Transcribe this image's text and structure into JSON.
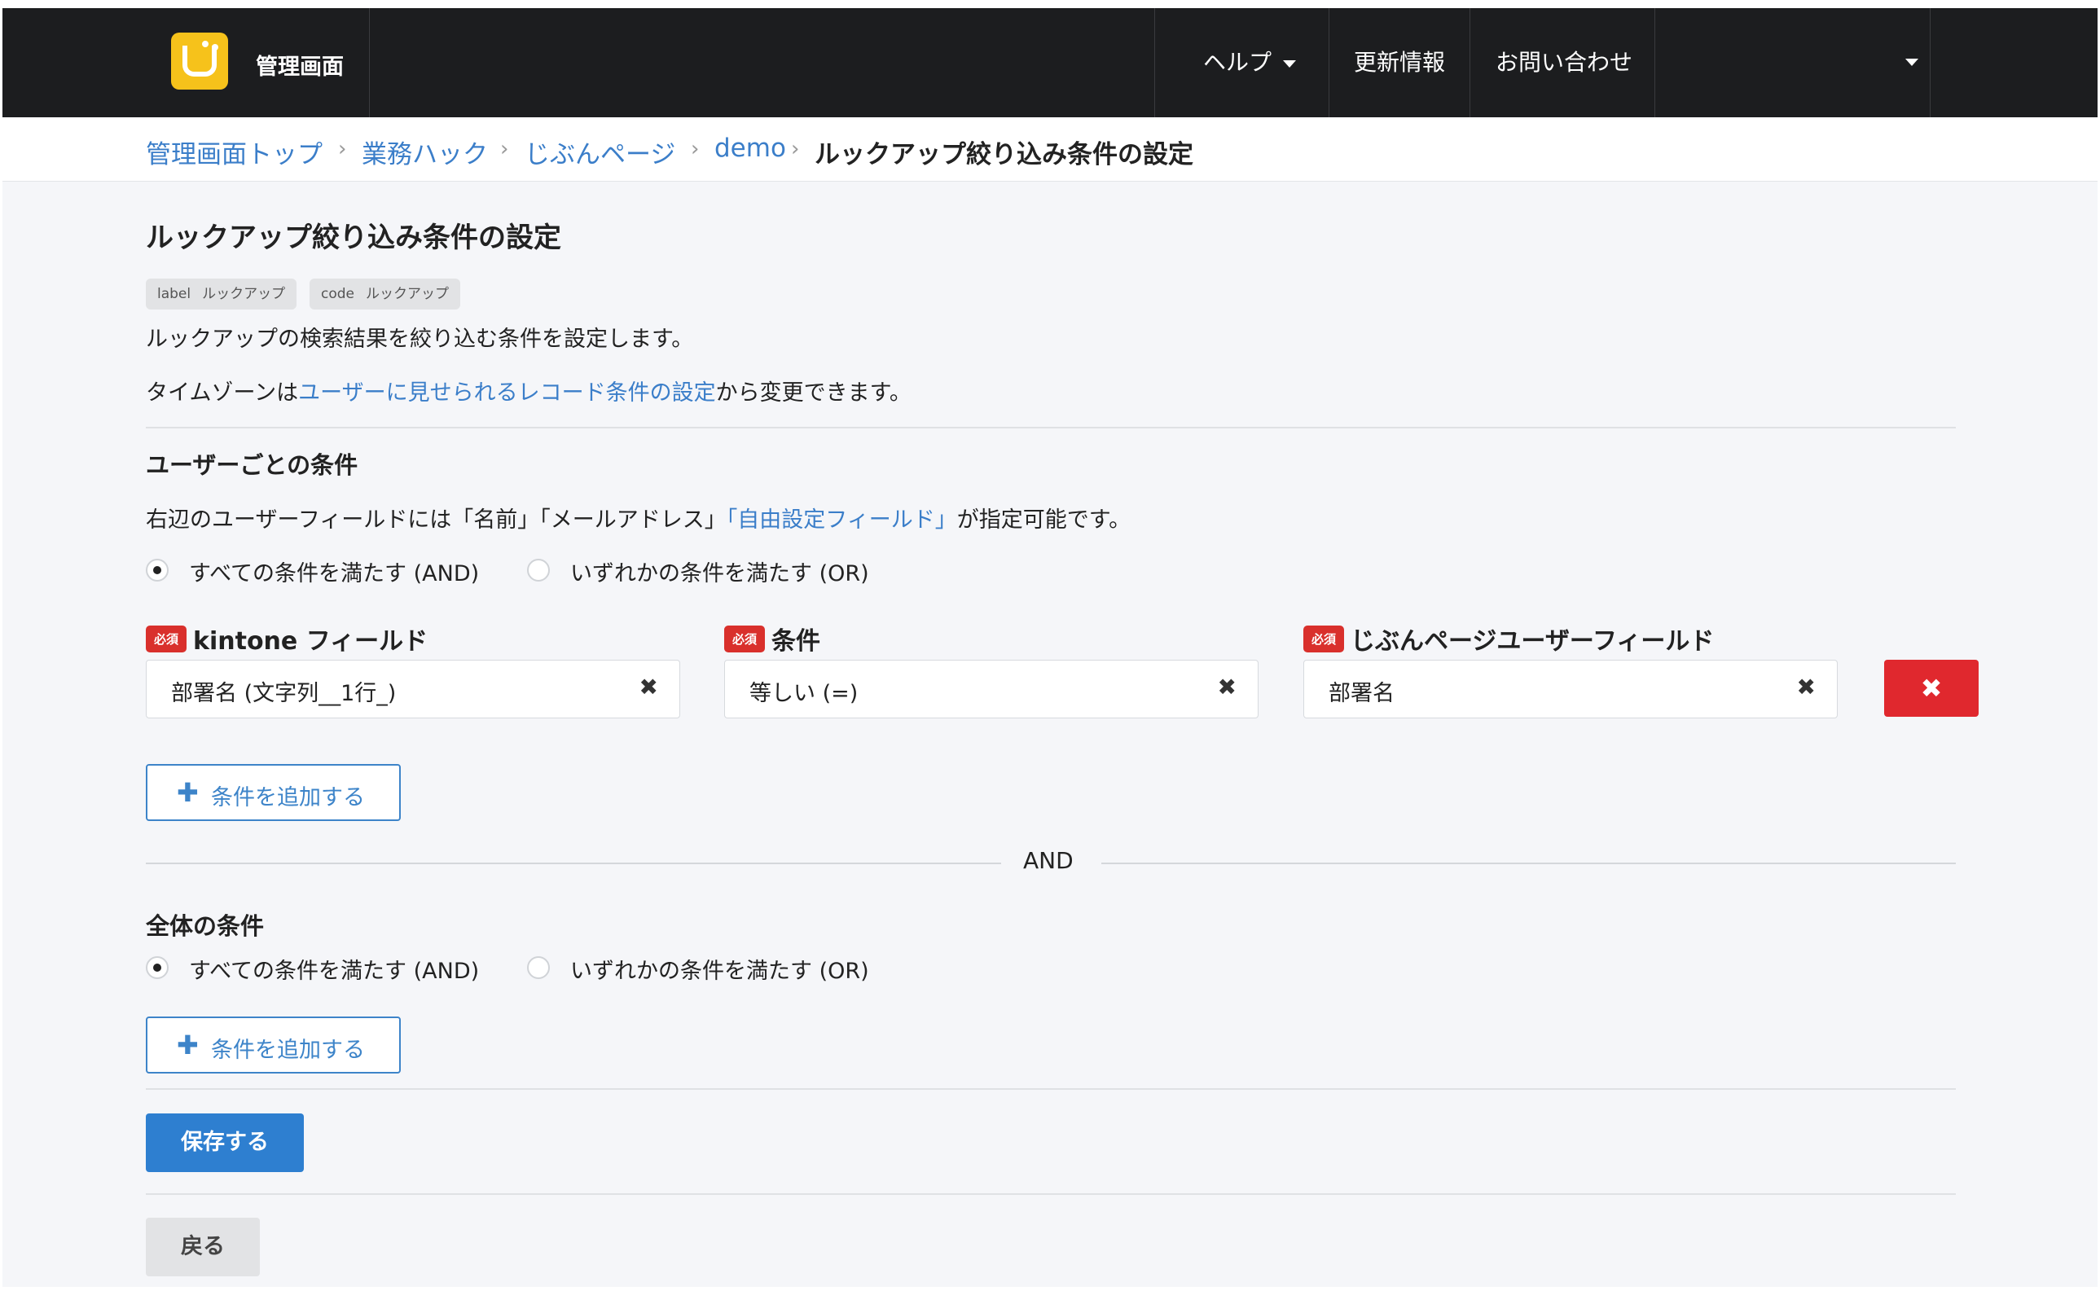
{
  "header": {
    "app_title": "管理画面",
    "nav": [
      {
        "label": "ヘルプ",
        "has_dropdown": true
      },
      {
        "label": "更新情報",
        "has_dropdown": false
      },
      {
        "label": "お問い合わせ",
        "has_dropdown": false
      }
    ],
    "colors": {
      "bar": "#1c1d1f",
      "logo": "#f6c21b"
    }
  },
  "breadcrumb": {
    "items": [
      "管理画面トップ",
      "業務ハック",
      "じぶんページ",
      "demo"
    ],
    "current": "ルックアップ絞り込み条件の設定",
    "separator": "›"
  },
  "page": {
    "title": "ルックアップ絞り込み条件の設定",
    "tags": [
      {
        "key": "label",
        "value": "ルックアップ"
      },
      {
        "key": "code",
        "value": "ルックアップ"
      }
    ],
    "description": "ルックアップの検索結果を絞り込む条件を設定します。",
    "timezone_prefix": "タイムゾーンは",
    "timezone_link": "ユーザーに見せられるレコード条件の設定",
    "timezone_suffix": "から変更できます。"
  },
  "user_conditions": {
    "title": "ユーザーごとの条件",
    "note_prefix": "右辺のユーザーフィールドには「名前」「メールアドレス」",
    "note_link": "「自由設定フィールド」",
    "note_suffix": "が指定可能です。",
    "radio_and": "すべての条件を満たす (AND)",
    "radio_or": "いずれかの条件を満たす (OR)",
    "selected": "AND",
    "required_badge": "必須",
    "columns": {
      "kintone_field": "kintone フィールド",
      "condition": "条件",
      "user_field": "じぶんページユーザーフィールド"
    },
    "rows": [
      {
        "kintone_field": "部署名 (文字列__1行_)",
        "condition": "等しい (=)",
        "user_field": "部署名"
      }
    ],
    "clear_icon": "✖",
    "delete_icon": "✖",
    "add_label": "条件を追加する",
    "add_icon": "✚"
  },
  "and_divider": "AND",
  "global_conditions": {
    "title": "全体の条件",
    "radio_and": "すべての条件を満たす (AND)",
    "radio_or": "いずれかの条件を満たす (OR)",
    "selected": "AND",
    "add_label": "条件を追加する",
    "add_icon": "✚"
  },
  "actions": {
    "save": "保存する",
    "back": "戻る",
    "colors": {
      "save": "#2e7fd0",
      "delete": "#e0282e",
      "badge": "#d9302c",
      "link": "#3b7ec9"
    }
  }
}
